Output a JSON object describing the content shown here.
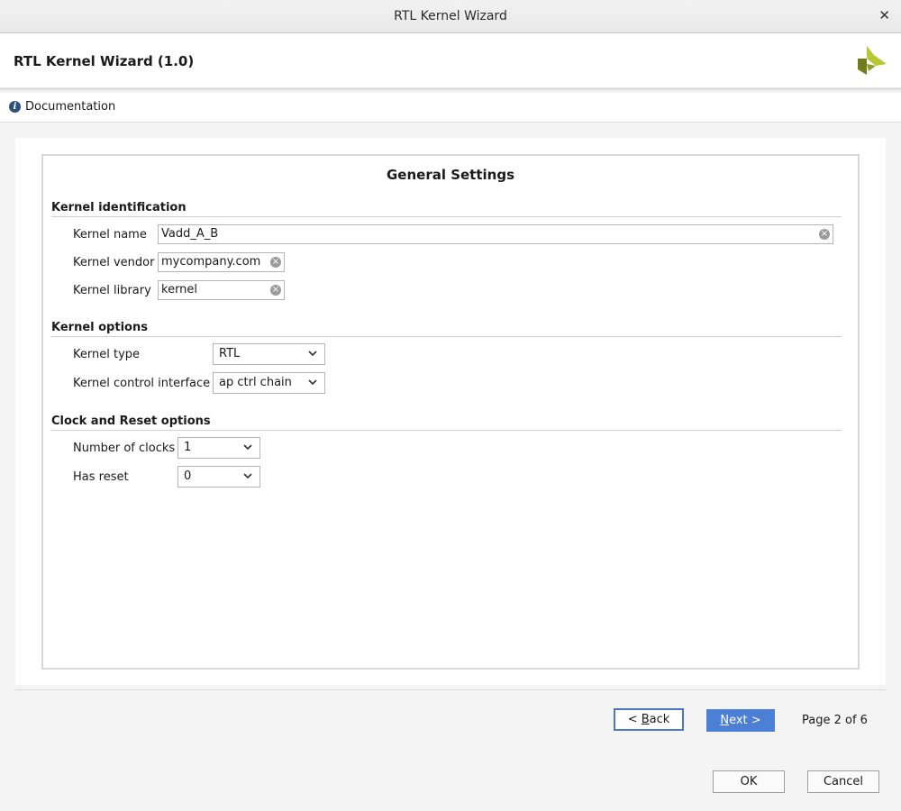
{
  "window": {
    "title": "RTL Kernel Wizard",
    "close_glyph": "✕"
  },
  "header": {
    "heading": "RTL Kernel Wizard (1.0)",
    "logo_icon": "xilinx-logo"
  },
  "docbar": {
    "documentation_label": "Documentation",
    "icon": "info-icon"
  },
  "page": {
    "title": "General Settings"
  },
  "kernel_identification": {
    "heading": "Kernel identification",
    "name_label": "Kernel name",
    "name_value": "Vadd_A_B",
    "vendor_label": "Kernel vendor",
    "vendor_value": "mycompany.com",
    "library_label": "Kernel library",
    "library_value": "kernel"
  },
  "kernel_options": {
    "heading": "Kernel options",
    "type_label": "Kernel type",
    "type_value": "RTL",
    "control_label": "Kernel control interface",
    "control_value": "ap ctrl chain"
  },
  "clock_reset": {
    "heading": "Clock and Reset options",
    "clocks_label": "Number of clocks",
    "clocks_value": "1",
    "reset_label": "Has reset",
    "reset_value": "0"
  },
  "navigation": {
    "back_prefix": "< ",
    "back_mnemonic": "B",
    "back_rest": "ack",
    "next_mnemonic": "N",
    "next_rest": "ext >",
    "page_indicator": "Page 2 of 6"
  },
  "footer": {
    "ok_label": "OK",
    "cancel_label": "Cancel"
  },
  "colors": {
    "accent": "#4c7fd6",
    "logo_light": "#b6c731",
    "logo_dark": "#6f7d1c"
  }
}
